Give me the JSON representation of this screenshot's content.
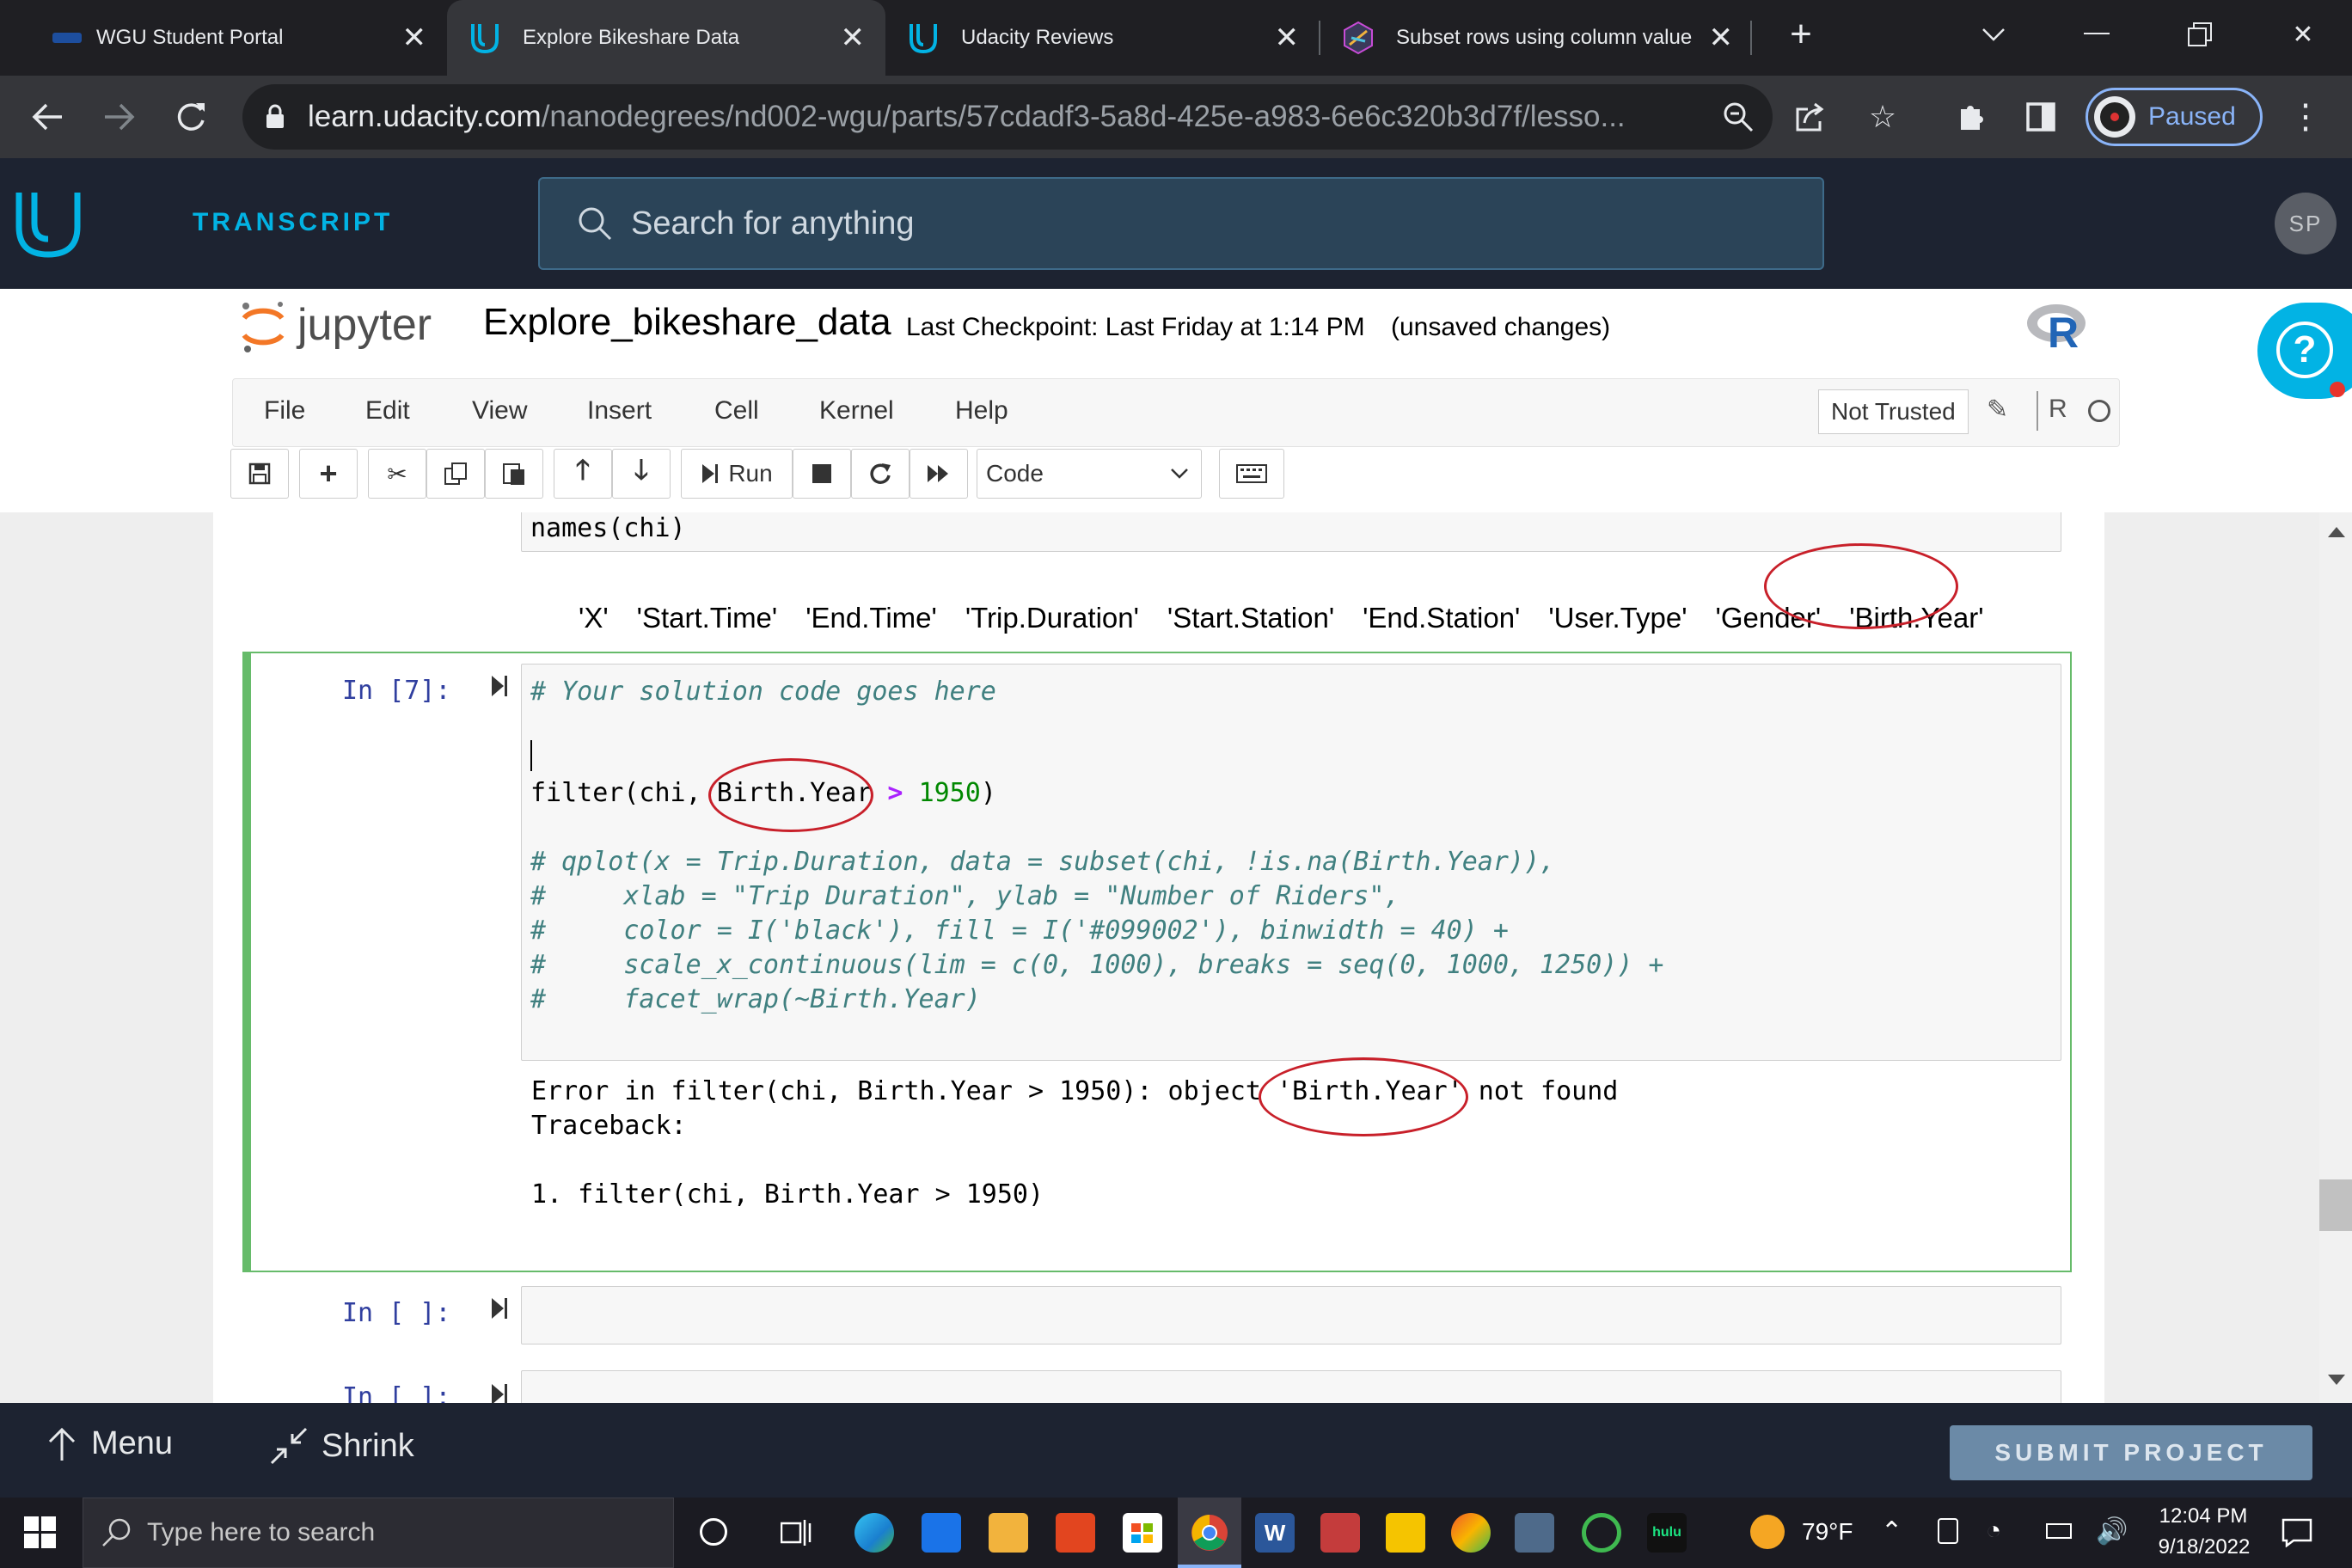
{
  "browser": {
    "tabs": [
      {
        "label": "WGU Student Portal",
        "icon": "wgu-icon"
      },
      {
        "label": "Explore Bikeshare Data",
        "icon": "udacity-icon",
        "active": true
      },
      {
        "label": "Udacity Reviews",
        "icon": "udacity-icon"
      },
      {
        "label": "Subset rows using column value",
        "icon": "dplyr-hex-icon"
      }
    ],
    "url_host": "learn.udacity.com",
    "url_path": "/nanodegrees/nd002-wgu/parts/57cdadf3-5a8d-425e-a983-6e6c320b3d7f/lesso...",
    "profile_status": "Paused"
  },
  "udacity": {
    "nav_label": "TRANSCRIPT",
    "search_placeholder": "Search for anything",
    "avatar_initials": "SP",
    "footer_menu": "Menu",
    "footer_shrink": "Shrink",
    "submit_label": "SUBMIT PROJECT",
    "accent": "#02b3e4"
  },
  "jupyter": {
    "logo_text": "jupyter",
    "notebook_name": "Explore_bikeshare_data",
    "checkpoint": "Last Checkpoint: Last Friday at 1:14 PM",
    "unsaved": "(unsaved changes)",
    "menu": [
      "File",
      "Edit",
      "View",
      "Insert",
      "Cell",
      "Kernel",
      "Help"
    ],
    "trust": "Not Trusted",
    "kernel_name": "R",
    "run_label": "Run",
    "cell_type": "Code"
  },
  "cells": {
    "prev_code": "names(chi)",
    "prev_output": [
      "'X'",
      "'Start.Time'",
      "'End.Time'",
      "'Trip.Duration'",
      "'Start.Station'",
      "'End.Station'",
      "'User.Type'",
      "'Gender'",
      "'Birth.Year'"
    ],
    "active_prompt": "In [7]:",
    "code_comment": "# Your solution code goes here",
    "code_filter_prefix": "filter(chi, ",
    "code_filter_arg": "Birth.Year",
    "code_filter_op": " > ",
    "code_filter_num": "1950",
    "code_filter_suffix": ")",
    "commented_lines": [
      "# qplot(x = Trip.Duration, data = subset(chi, !is.na(Birth.Year)),",
      "#     xlab = \"Trip Duration\", ylab = \"Number of Riders\",",
      "#     color = I('black'), fill = I('#099002'), binwidth = 40) +",
      "#     scale_x_continuous(lim = c(0, 1000), breaks = seq(0, 1000, 1250)) +",
      "#     facet_wrap(~Birth.Year)"
    ],
    "error_prefix": "Error in filter(chi, Birth.Year > 1950): object ",
    "error_obj": "'Birth.Year'",
    "error_suffix": " not found",
    "traceback_label": "Traceback:",
    "traceback_line": "1. filter(chi, Birth.Year > 1950)",
    "empty_prompt": "In [ ]:",
    "partial_prompt": "In [ ]:"
  },
  "taskbar": {
    "search_placeholder": "Type here to search",
    "weather": "79°F",
    "time": "12:04 PM",
    "date": "9/18/2022"
  }
}
